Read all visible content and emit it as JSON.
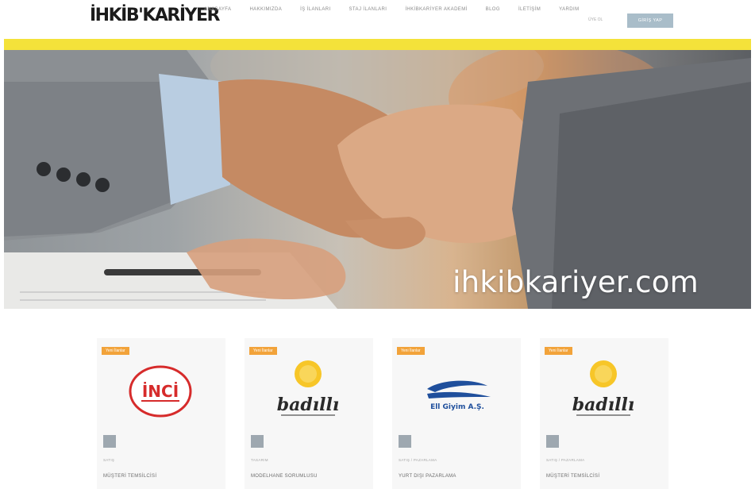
{
  "header": {
    "logo_text": "İHKİB'KARİYER",
    "nav": [
      "ANASAYFA",
      "HAKKIMIZDA",
      "İŞ İLANLARI",
      "STAJ İLANLARI",
      "İHKİBKARİYER AKADEMİ",
      "BLOG",
      "İLETİŞİM",
      "YARDIM"
    ],
    "small_link": "ÜYE OL",
    "login_label": "GİRİŞ YAP"
  },
  "hero": {
    "caption": "ihkibkariyer.com"
  },
  "cards": [
    {
      "badge": "Yeni İlanlar",
      "logo": "İNCİ",
      "category": "SATIŞ",
      "title": "MÜŞTERİ TEMSİLCİSİ"
    },
    {
      "badge": "Yeni İlanlar",
      "logo": "badıllı",
      "category": "TASARIM",
      "title": "MODELHANE SORUMLUSU"
    },
    {
      "badge": "Yeni İlanlar",
      "logo": "Ell Giyim A.Ş.",
      "category": "SATIŞ / PAZARLAMA",
      "title": "YURT DIŞI PAZARLAMA"
    },
    {
      "badge": "Yeni İlanlar",
      "logo": "badıllı",
      "category": "SATIŞ / PAZARLAMA",
      "title": "MÜŞTERİ TEMSİLCİSİ"
    }
  ],
  "colors": {
    "accent_yellow": "#f4e23a",
    "badge_orange": "#f2a33a",
    "login_button": "#a9bdc9",
    "inci_red": "#d62b2b",
    "ell_blue": "#1f4f9c",
    "sun_yellow": "#f7c628"
  },
  "icons": {
    "card_icon": "category-square-icon"
  }
}
